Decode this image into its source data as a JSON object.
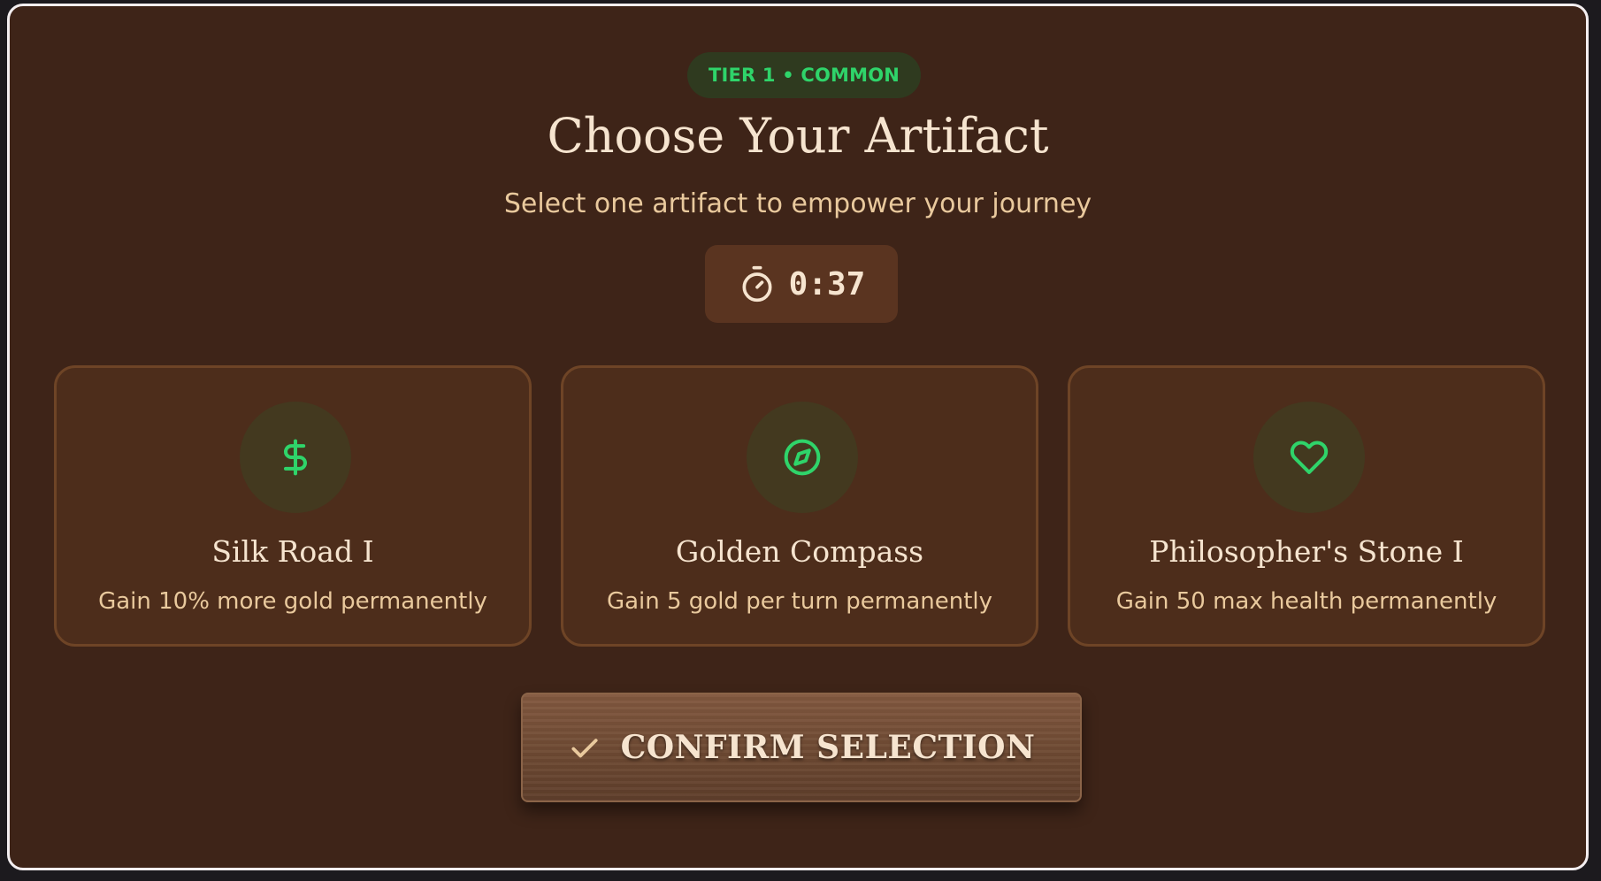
{
  "header": {
    "tier_badge": "TIER 1 • COMMON",
    "title": "Choose Your Artifact",
    "subtitle": "Select one artifact to empower your journey"
  },
  "timer": {
    "icon": "stopwatch-icon",
    "value": "0:37"
  },
  "artifacts": [
    {
      "icon": "dollar-icon",
      "name": "Silk Road I",
      "description": "Gain 10% more gold permanently"
    },
    {
      "icon": "compass-icon",
      "name": "Golden Compass",
      "description": "Gain 5 gold per turn permanently"
    },
    {
      "icon": "heart-icon",
      "name": "Philosopher's Stone I",
      "description": "Gain 50 max health permanently"
    }
  ],
  "confirm": {
    "icon": "check-icon",
    "label": "CONFIRM SELECTION"
  },
  "colors": {
    "background": "#3e2418",
    "card": "#4d2d1b",
    "accent_green": "#2fd46a",
    "title_text": "#f6e4cf",
    "secondary_text": "#e9c99d"
  }
}
